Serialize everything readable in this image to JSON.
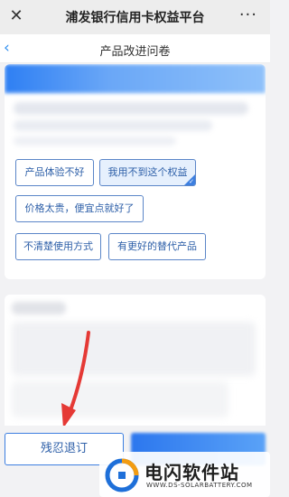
{
  "titlebar": {
    "close_glyph": "✕",
    "title": "浦发银行信用卡权益平台",
    "more_glyph": "···"
  },
  "navbar": {
    "back_glyph": "‹",
    "title": "产品改进问卷"
  },
  "options": [
    {
      "label": "产品体验不好",
      "selected": false
    },
    {
      "label": "我用不到这个权益",
      "selected": true
    },
    {
      "label": "价格太贵，便宜点就好了",
      "selected": false
    },
    {
      "label": "不清楚使用方式",
      "selected": false
    },
    {
      "label": "有更好的替代产品",
      "selected": false
    }
  ],
  "buttons": {
    "cancel_label": "残忍退订",
    "submit_label": ""
  },
  "watermark": {
    "text": "电闪软件站",
    "url": "WWW.DS-SOLARBATTERY.COM"
  },
  "colors": {
    "accent": "#3d7fe0",
    "option_text": "#2d5fa8",
    "arrow": "#e53935"
  },
  "icons": {
    "close": "close-icon",
    "more": "more-icon",
    "back": "back-icon",
    "check": "check-icon",
    "arrow": "red-arrow-annotation",
    "logo": "watermark-logo-icon"
  }
}
